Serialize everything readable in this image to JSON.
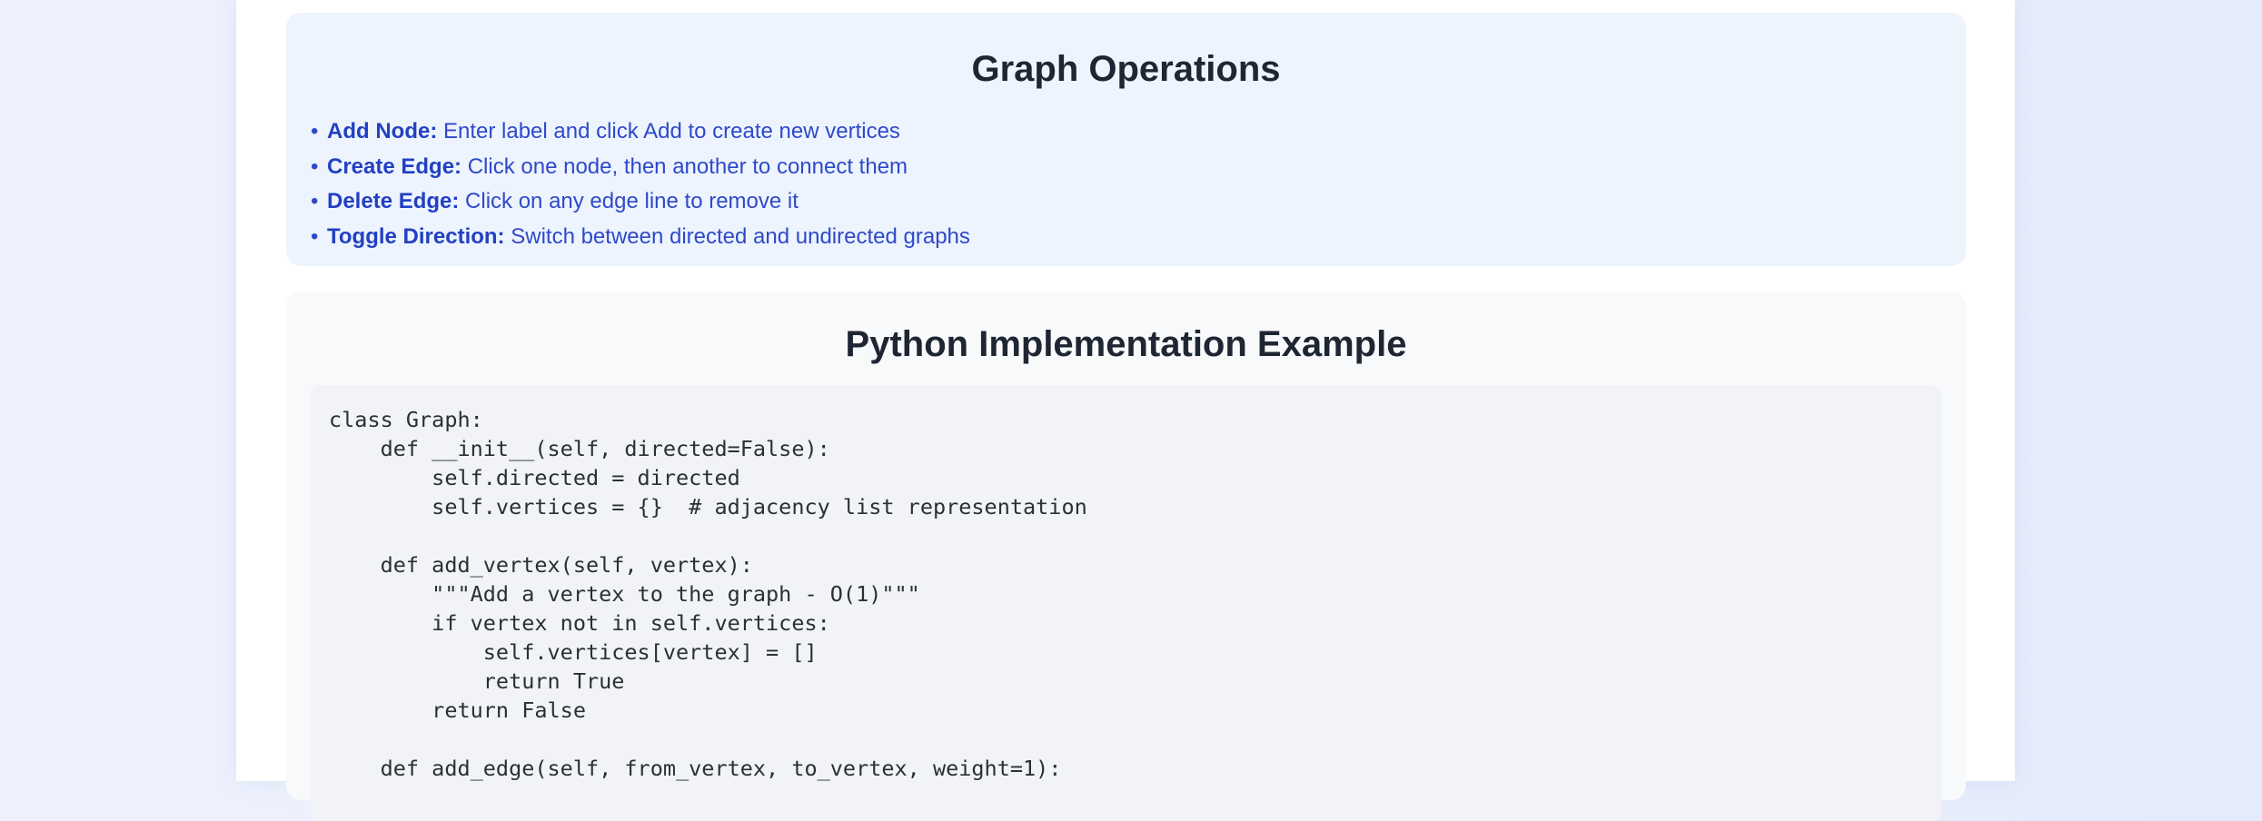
{
  "operations": {
    "title": "Graph Operations",
    "bullet": "•",
    "items": [
      {
        "term": "Add Node:",
        "desc": " Enter label and click Add to create new vertices"
      },
      {
        "term": "Create Edge:",
        "desc": " Click one node, then another to connect them"
      },
      {
        "term": "Delete Edge:",
        "desc": " Click on any edge line to remove it"
      },
      {
        "term": "Toggle Direction:",
        "desc": " Switch between directed and undirected graphs"
      }
    ]
  },
  "example": {
    "title": "Python Implementation Example",
    "code": "class Graph:\n    def __init__(self, directed=False):\n        self.directed = directed\n        self.vertices = {}  # adjacency list representation\n\n    def add_vertex(self, vertex):\n        \"\"\"Add a vertex to the graph - O(1)\"\"\"\n        if vertex not in self.vertices:\n            self.vertices[vertex] = []\n            return True\n        return False\n\n    def add_edge(self, from_vertex, to_vertex, weight=1):"
  },
  "colors": {
    "ops_background": "#edf4fe",
    "ops_text": "#2f49c9",
    "code_background": "#f1f3f6"
  }
}
